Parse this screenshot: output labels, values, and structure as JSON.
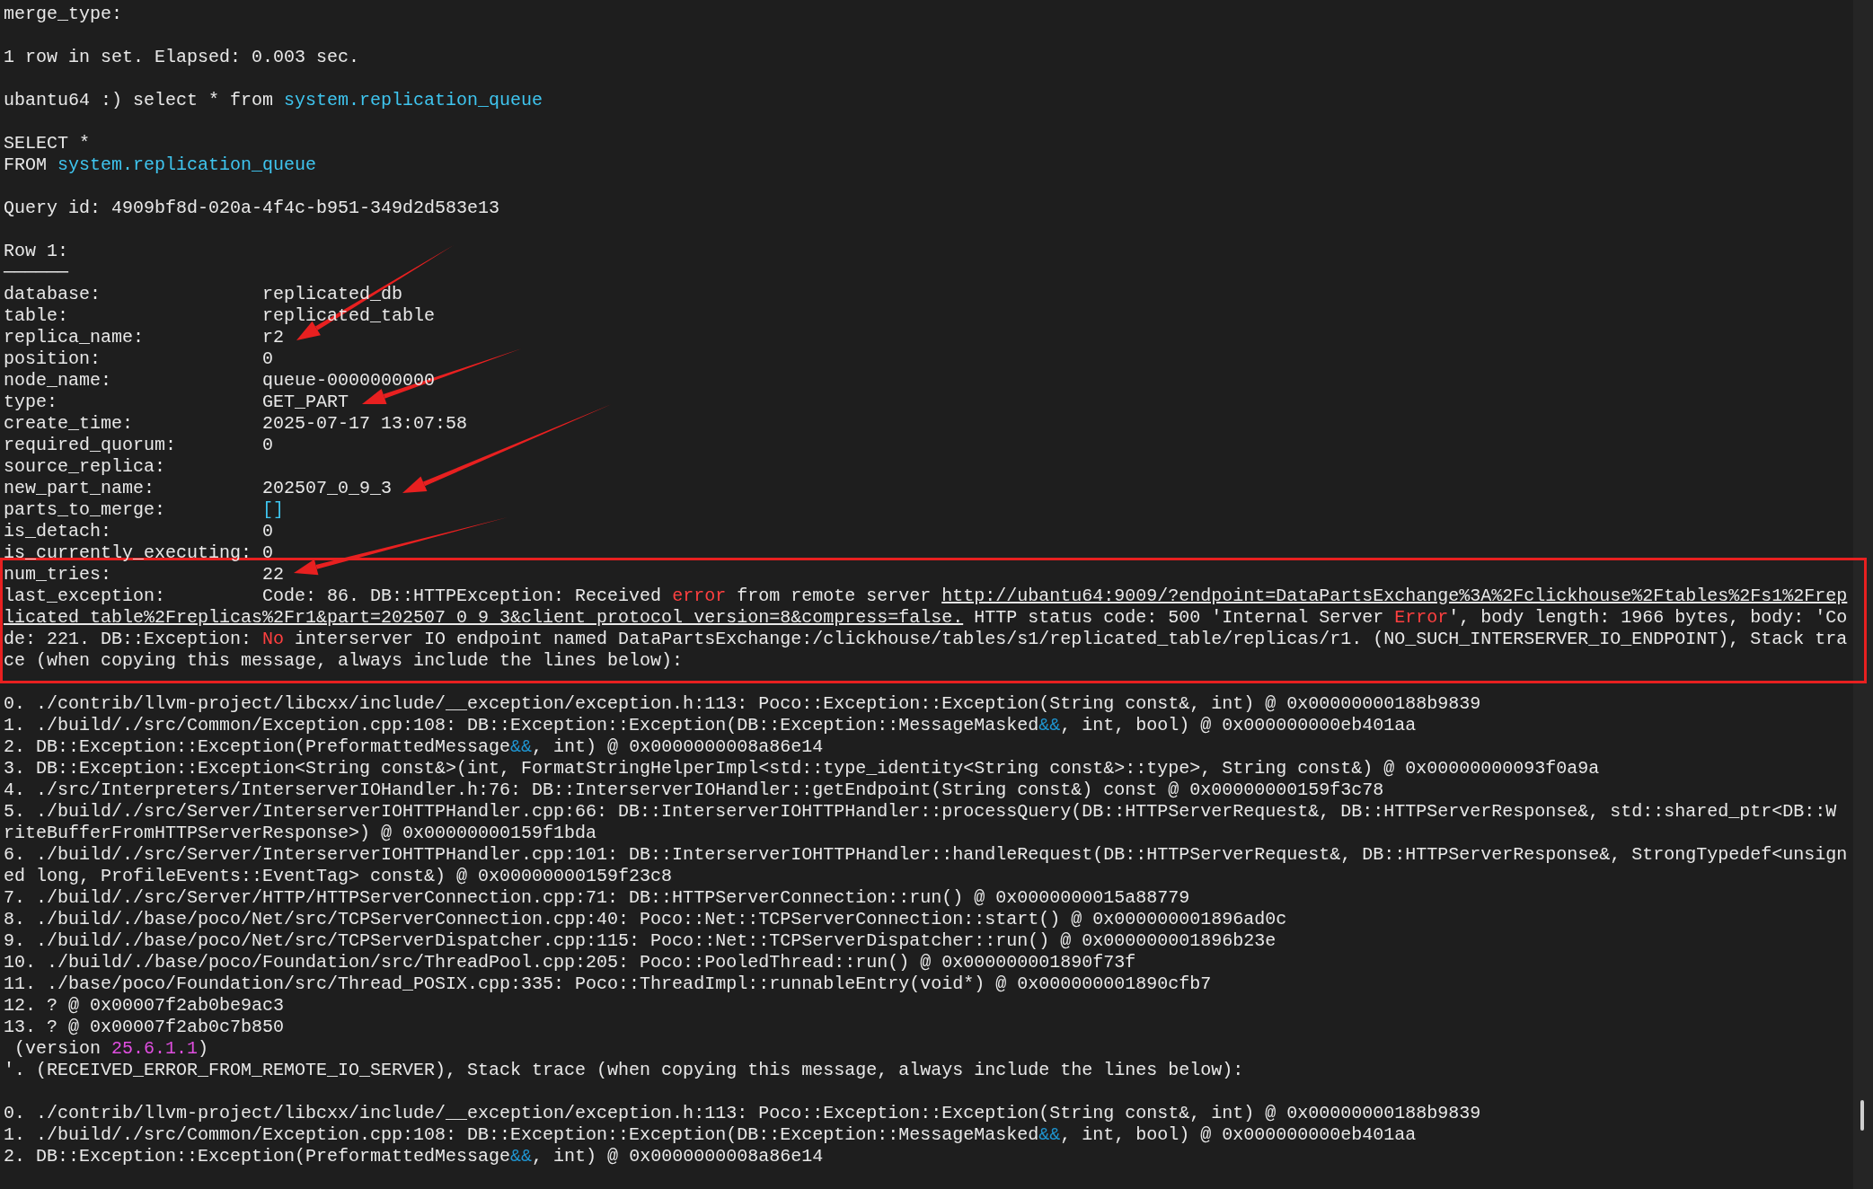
{
  "terminal": {
    "lines": [
      {
        "kind": "text",
        "segments": [
          {
            "kind": "plain",
            "text": "merge_type:"
          }
        ]
      },
      {
        "kind": "blank"
      },
      {
        "kind": "text",
        "segments": [
          {
            "kind": "plain",
            "text": "1 row in set. Elapsed: 0.003 sec."
          }
        ]
      },
      {
        "kind": "blank"
      },
      {
        "kind": "text",
        "segments": [
          {
            "kind": "plain",
            "text": "ubantu64 :) select * from "
          },
          {
            "kind": "keyword",
            "text": "system.replication_queue"
          }
        ]
      },
      {
        "kind": "blank"
      },
      {
        "kind": "text",
        "segments": [
          {
            "kind": "plain",
            "text": "SELECT *"
          }
        ]
      },
      {
        "kind": "text",
        "segments": [
          {
            "kind": "plain",
            "text": "FROM "
          },
          {
            "kind": "keyword",
            "text": "system.replication_queue"
          }
        ]
      },
      {
        "kind": "blank"
      },
      {
        "kind": "text",
        "segments": [
          {
            "kind": "plain",
            "text": "Query id: 4909bf8d-020a-4f4c-b951-349d2d583e13"
          }
        ]
      },
      {
        "kind": "blank"
      },
      {
        "kind": "text",
        "segments": [
          {
            "kind": "plain",
            "text": "Row 1:"
          }
        ]
      },
      {
        "kind": "rule",
        "text": "──────"
      },
      {
        "kind": "field",
        "label": "database:",
        "segments": [
          {
            "kind": "plain",
            "text": "replicated_db"
          }
        ]
      },
      {
        "kind": "field",
        "label": "table:",
        "segments": [
          {
            "kind": "plain",
            "text": "replicated_table"
          }
        ]
      },
      {
        "kind": "field",
        "label": "replica_name:",
        "segments": [
          {
            "kind": "plain",
            "text": "r2"
          }
        ]
      },
      {
        "kind": "field",
        "label": "position:",
        "segments": [
          {
            "kind": "plain",
            "text": "0"
          }
        ]
      },
      {
        "kind": "field",
        "label": "node_name:",
        "segments": [
          {
            "kind": "plain",
            "text": "queue-0000000000"
          }
        ]
      },
      {
        "kind": "field",
        "label": "type:",
        "segments": [
          {
            "kind": "plain",
            "text": "GET_PART"
          }
        ]
      },
      {
        "kind": "field",
        "label": "create_time:",
        "segments": [
          {
            "kind": "plain",
            "text": "2025-07-17 13:07:58"
          }
        ]
      },
      {
        "kind": "field",
        "label": "required_quorum:",
        "segments": [
          {
            "kind": "plain",
            "text": "0"
          }
        ]
      },
      {
        "kind": "field",
        "label": "source_replica:"
      },
      {
        "kind": "field",
        "label": "new_part_name:",
        "segments": [
          {
            "kind": "plain",
            "text": "202507_0_9_3"
          }
        ]
      },
      {
        "kind": "field",
        "label": "parts_to_merge:",
        "segments": [
          {
            "kind": "keyword",
            "text": "[]"
          }
        ]
      },
      {
        "kind": "field",
        "label": "is_detach:",
        "segments": [
          {
            "kind": "plain",
            "text": "0"
          }
        ]
      },
      {
        "kind": "field",
        "label": "is_currently_executing:",
        "segments": [
          {
            "kind": "plain",
            "text": "0"
          }
        ]
      },
      {
        "kind": "group",
        "lines": [
          {
            "kind": "field",
            "label": "num_tries:",
            "segments": [
              {
                "kind": "plain",
                "text": "22"
              }
            ]
          },
          {
            "kind": "field",
            "label": "last_exception:",
            "segments": [
              {
                "kind": "plain",
                "text": "Code: 86. DB::HTTPException: Received "
              },
              {
                "kind": "error",
                "text": "error"
              },
              {
                "kind": "plain",
                "text": " from remote server "
              },
              {
                "kind": "link",
                "text": "http://ubantu64:9009/?endpoint=DataPartsExchange%3A%2Fclickhouse%2Ftables%2Fs1%2Frep"
              }
            ]
          },
          {
            "kind": "text",
            "segments": [
              {
                "kind": "link",
                "text": "licated_table%2Freplicas%2Fr1&part=202507_0_9_3&client_protocol_version=8&compress=false."
              },
              {
                "kind": "plain",
                "text": " HTTP status code: 500 'Internal Server "
              },
              {
                "kind": "error",
                "text": "Error"
              },
              {
                "kind": "plain",
                "text": "', body length: 1966 bytes, body: 'Co"
              }
            ]
          },
          {
            "kind": "text",
            "segments": [
              {
                "kind": "plain",
                "text": "de: 221. DB::Exception: "
              },
              {
                "kind": "error",
                "text": "No"
              },
              {
                "kind": "plain",
                "text": " interserver IO endpoint named DataPartsExchange:/clickhouse/tables/s1/replicated_table/replicas/r1. (NO_SUCH_INTERSERVER_IO_ENDPOINT), Stack tra"
              }
            ]
          },
          {
            "kind": "text",
            "segments": [
              {
                "kind": "plain",
                "text": "ce (when copying this message, always include the lines below):"
              }
            ]
          }
        ]
      },
      {
        "kind": "blank"
      },
      {
        "kind": "text",
        "segments": [
          {
            "kind": "plain",
            "text": "0. ./contrib/llvm-project/libcxx/include/__exception/exception.h:113: Poco::Exception::Exception(String const&, int) @ 0x00000000188b9839"
          }
        ]
      },
      {
        "kind": "text",
        "segments": [
          {
            "kind": "plain",
            "text": "1. ./build/./src/Common/Exception.cpp:108: DB::Exception::Exception(DB::Exception::MessageMasked"
          },
          {
            "kind": "operator",
            "text": "&&"
          },
          {
            "kind": "plain",
            "text": ", int, bool) @ 0x000000000eb401aa"
          }
        ]
      },
      {
        "kind": "text",
        "segments": [
          {
            "kind": "plain",
            "text": "2. DB::Exception::Exception(PreformattedMessage"
          },
          {
            "kind": "operator",
            "text": "&&"
          },
          {
            "kind": "plain",
            "text": ", int) @ 0x0000000008a86e14"
          }
        ]
      },
      {
        "kind": "text",
        "segments": [
          {
            "kind": "plain",
            "text": "3. DB::Exception::Exception<String const&>(int, FormatStringHelperImpl<std::type_identity<String const&>::type>, String const&) @ 0x00000000093f0a9a"
          }
        ]
      },
      {
        "kind": "text",
        "segments": [
          {
            "kind": "plain",
            "text": "4. ./src/Interpreters/InterserverIOHandler.h:76: DB::InterserverIOHandler::getEndpoint(String const&) const @ 0x00000000159f3c78"
          }
        ]
      },
      {
        "kind": "text",
        "segments": [
          {
            "kind": "plain",
            "text": "5. ./build/./src/Server/InterserverIOHTTPHandler.cpp:66: DB::InterserverIOHTTPHandler::processQuery(DB::HTTPServerRequest&, DB::HTTPServerResponse&, std::shared_ptr<DB::W"
          }
        ]
      },
      {
        "kind": "text",
        "segments": [
          {
            "kind": "plain",
            "text": "riteBufferFromHTTPServerResponse>) @ 0x00000000159f1bda"
          }
        ]
      },
      {
        "kind": "text",
        "segments": [
          {
            "kind": "plain",
            "text": "6. ./build/./src/Server/InterserverIOHTTPHandler.cpp:101: DB::InterserverIOHTTPHandler::handleRequest(DB::HTTPServerRequest&, DB::HTTPServerResponse&, StrongTypedef<unsign"
          }
        ]
      },
      {
        "kind": "text",
        "segments": [
          {
            "kind": "plain",
            "text": "ed long, ProfileEvents::EventTag> const&) @ 0x00000000159f23c8"
          }
        ]
      },
      {
        "kind": "text",
        "segments": [
          {
            "kind": "plain",
            "text": "7. ./build/./src/Server/HTTP/HTTPServerConnection.cpp:71: DB::HTTPServerConnection::run() @ 0x0000000015a88779"
          }
        ]
      },
      {
        "kind": "text",
        "segments": [
          {
            "kind": "plain",
            "text": "8. ./build/./base/poco/Net/src/TCPServerConnection.cpp:40: Poco::Net::TCPServerConnection::start() @ 0x000000001896ad0c"
          }
        ]
      },
      {
        "kind": "text",
        "segments": [
          {
            "kind": "plain",
            "text": "9. ./build/./base/poco/Net/src/TCPServerDispatcher.cpp:115: Poco::Net::TCPServerDispatcher::run() @ 0x000000001896b23e"
          }
        ]
      },
      {
        "kind": "text",
        "segments": [
          {
            "kind": "plain",
            "text": "10. ./build/./base/poco/Foundation/src/ThreadPool.cpp:205: Poco::PooledThread::run() @ 0x000000001890f73f"
          }
        ]
      },
      {
        "kind": "text",
        "segments": [
          {
            "kind": "plain",
            "text": "11. ./base/poco/Foundation/src/Thread_POSIX.cpp:335: Poco::ThreadImpl::runnableEntry(void*) @ 0x000000001890cfb7"
          }
        ]
      },
      {
        "kind": "text",
        "segments": [
          {
            "kind": "plain",
            "text": "12. ? @ 0x00007f2ab0be9ac3"
          }
        ]
      },
      {
        "kind": "text",
        "segments": [
          {
            "kind": "plain",
            "text": "13. ? @ 0x00007f2ab0c7b850"
          }
        ]
      },
      {
        "kind": "text",
        "segments": [
          {
            "kind": "plain",
            "text": " (version "
          },
          {
            "kind": "number",
            "text": "25.6.1.1"
          },
          {
            "kind": "plain",
            "text": ")"
          }
        ]
      },
      {
        "kind": "text",
        "segments": [
          {
            "kind": "plain",
            "text": "'. (RECEIVED_ERROR_FROM_REMOTE_IO_SERVER), Stack trace (when copying this message, always include the lines below):"
          }
        ]
      },
      {
        "kind": "blank"
      },
      {
        "kind": "text",
        "segments": [
          {
            "kind": "plain",
            "text": "0. ./contrib/llvm-project/libcxx/include/__exception/exception.h:113: Poco::Exception::Exception(String const&, int) @ 0x00000000188b9839"
          }
        ]
      },
      {
        "kind": "text",
        "segments": [
          {
            "kind": "plain",
            "text": "1. ./build/./src/Common/Exception.cpp:108: DB::Exception::Exception(DB::Exception::MessageMasked"
          },
          {
            "kind": "operator",
            "text": "&&"
          },
          {
            "kind": "plain",
            "text": ", int, bool) @ 0x000000000eb401aa"
          }
        ]
      },
      {
        "kind": "text",
        "segments": [
          {
            "kind": "plain",
            "text": "2. DB::Exception::Exception(PreformattedMessage"
          },
          {
            "kind": "operator",
            "text": "&&"
          },
          {
            "kind": "plain",
            "text": ", int) @ 0x0000000008a86e14"
          }
        ]
      }
    ]
  }
}
